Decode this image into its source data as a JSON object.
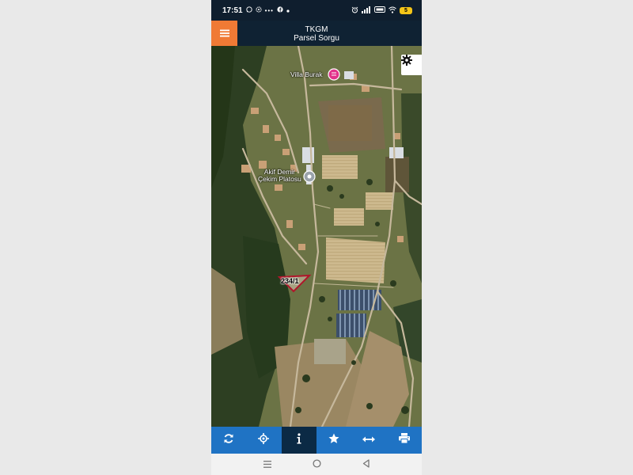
{
  "status_bar": {
    "time": "17:51",
    "left_icons": [
      "whatsapp-icon",
      "settings-small-icon",
      "dots-icon",
      "facebook-icon",
      "dot-icon"
    ],
    "right_icons": [
      "alarm-icon",
      "signal-icon",
      "volte-icon",
      "wifi-icon",
      "battery-icon"
    ],
    "battery": "5"
  },
  "app_bar": {
    "title": "TKGM",
    "subtitle": "Parsel Sorgu",
    "menu_icon": "hamburger-icon",
    "accent": "#f07a35"
  },
  "map": {
    "settings_icon": "gear-icon",
    "places": [
      {
        "name": "Villa Burak",
        "icon": "hotel-pin-icon",
        "pin_color": "#e2328a"
      },
      {
        "name_line1": "Akif Demir",
        "name_line2": "Çekim Platosu",
        "icon": "location-pin-icon"
      }
    ],
    "parcel_label": "234/1",
    "parcel_color": "#b0152a"
  },
  "toolbar": {
    "background": "#1f73c4",
    "active_background": "#0b2a45",
    "tools": [
      {
        "name": "refresh",
        "icon": "refresh-icon",
        "active": false
      },
      {
        "name": "locate",
        "icon": "crosshair-icon",
        "active": false
      },
      {
        "name": "info",
        "icon": "info-icon",
        "active": true
      },
      {
        "name": "favorites",
        "icon": "star-icon",
        "active": false
      },
      {
        "name": "measure",
        "icon": "measure-arrows-icon",
        "active": false
      },
      {
        "name": "print",
        "icon": "print-icon",
        "active": false
      }
    ]
  },
  "nav_bar": {
    "buttons": [
      "recent-apps-icon",
      "home-icon",
      "back-icon"
    ]
  }
}
